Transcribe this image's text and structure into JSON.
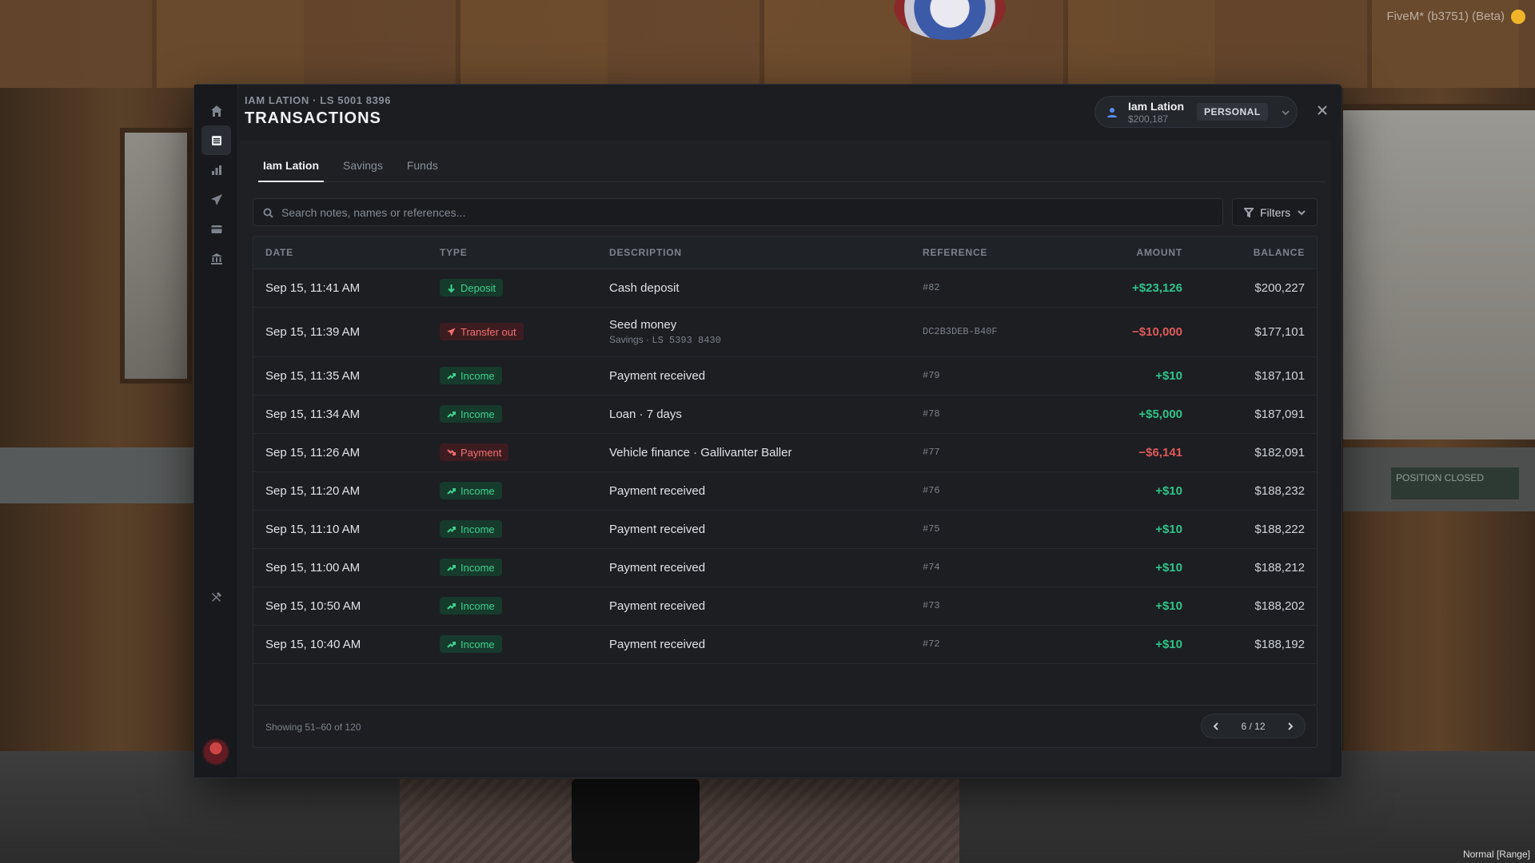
{
  "overlay": {
    "fivem_label": "FiveM* (b3751) (Beta)",
    "mode_label": "Normal [Range]",
    "sign_text": "POSITION CLOSED"
  },
  "header": {
    "breadcrumb": "IAM LATION · LS 5001 8396",
    "title": "TRANSACTIONS"
  },
  "account": {
    "name": "Iam Lation",
    "balance": "$200,187",
    "type": "PERSONAL"
  },
  "rail": {
    "icons": [
      "home-icon",
      "transactions-icon",
      "chart-icon",
      "send-icon",
      "card-icon",
      "bank-icon",
      "tools-icon"
    ],
    "active": "transactions-icon"
  },
  "tabs": [
    {
      "label": "Iam Lation",
      "active": true
    },
    {
      "label": "Savings",
      "active": false
    },
    {
      "label": "Funds",
      "active": false
    }
  ],
  "search": {
    "placeholder": "Search notes, names or references...",
    "value": ""
  },
  "filters_label": "Filters",
  "table": {
    "columns": {
      "date": "DATE",
      "type": "TYPE",
      "description": "DESCRIPTION",
      "reference": "REFERENCE",
      "amount": "AMOUNT",
      "balance": "BALANCE"
    },
    "rows": [
      {
        "date": "Sep 15, 11:41 AM",
        "type": "Deposit",
        "type_kind": "deposit",
        "description": "Cash deposit",
        "sub": null,
        "reference": "#82",
        "amount": "+$23,126",
        "amount_sign": "pos",
        "balance": "$200,227"
      },
      {
        "date": "Sep 15, 11:39 AM",
        "type": "Transfer out",
        "type_kind": "transfer",
        "description": "Seed money",
        "sub": {
          "account": "Savings",
          "sep": "·",
          "number": "LS 5393 8430"
        },
        "reference": "DC2B3DEB-B40F",
        "amount": "−$10,000",
        "amount_sign": "neg",
        "balance": "$177,101"
      },
      {
        "date": "Sep 15, 11:35 AM",
        "type": "Income",
        "type_kind": "income",
        "description": "Payment received",
        "sub": null,
        "reference": "#79",
        "amount": "+$10",
        "amount_sign": "pos",
        "balance": "$187,101"
      },
      {
        "date": "Sep 15, 11:34 AM",
        "type": "Income",
        "type_kind": "income",
        "description": "Loan · 7 days",
        "sub": null,
        "reference": "#78",
        "amount": "+$5,000",
        "amount_sign": "pos",
        "balance": "$187,091"
      },
      {
        "date": "Sep 15, 11:26 AM",
        "type": "Payment",
        "type_kind": "payment",
        "description": "Vehicle finance · Gallivanter Baller",
        "sub": null,
        "reference": "#77",
        "amount": "−$6,141",
        "amount_sign": "neg",
        "balance": "$182,091"
      },
      {
        "date": "Sep 15, 11:20 AM",
        "type": "Income",
        "type_kind": "income",
        "description": "Payment received",
        "sub": null,
        "reference": "#76",
        "amount": "+$10",
        "amount_sign": "pos",
        "balance": "$188,232"
      },
      {
        "date": "Sep 15, 11:10 AM",
        "type": "Income",
        "type_kind": "income",
        "description": "Payment received",
        "sub": null,
        "reference": "#75",
        "amount": "+$10",
        "amount_sign": "pos",
        "balance": "$188,222"
      },
      {
        "date": "Sep 15, 11:00 AM",
        "type": "Income",
        "type_kind": "income",
        "description": "Payment received",
        "sub": null,
        "reference": "#74",
        "amount": "+$10",
        "amount_sign": "pos",
        "balance": "$188,212"
      },
      {
        "date": "Sep 15, 10:50 AM",
        "type": "Income",
        "type_kind": "income",
        "description": "Payment received",
        "sub": null,
        "reference": "#73",
        "amount": "+$10",
        "amount_sign": "pos",
        "balance": "$188,202"
      },
      {
        "date": "Sep 15, 10:40 AM",
        "type": "Income",
        "type_kind": "income",
        "description": "Payment received",
        "sub": null,
        "reference": "#72",
        "amount": "+$10",
        "amount_sign": "pos",
        "balance": "$188,192"
      }
    ]
  },
  "footer": {
    "showing": "Showing 51–60 of 120",
    "page": "6 / 12"
  },
  "colors": {
    "positive": "#2fc487",
    "negative": "#e05a5a",
    "accent_user": "#5a8cf0"
  }
}
